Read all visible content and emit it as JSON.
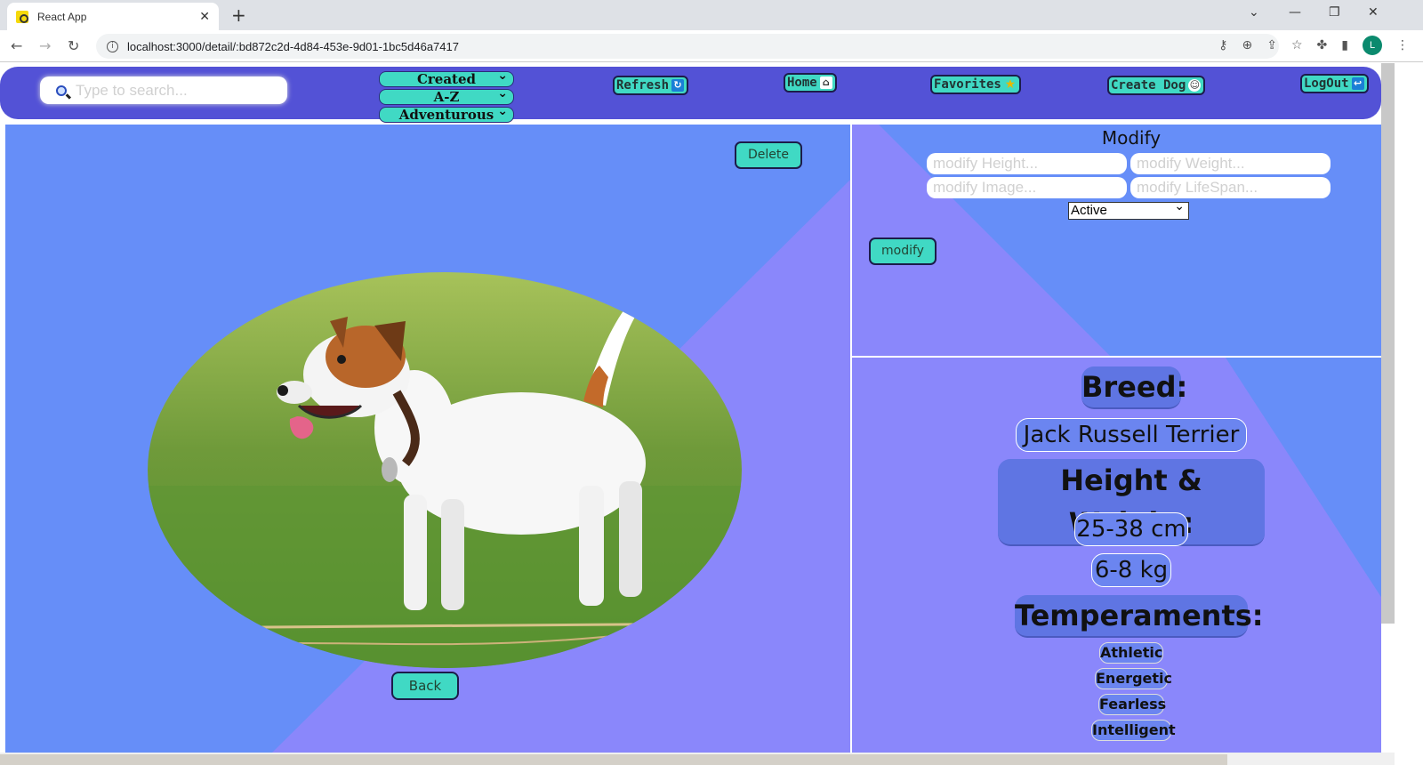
{
  "browser": {
    "tab_title": "React App",
    "url": "localhost:3000/detail/:bd872c2d-4d84-453e-9d01-1bc5d46a7417",
    "profile_initial": "L"
  },
  "navbar": {
    "search_placeholder": "Type to search...",
    "filters": [
      "Created",
      "A-Z",
      "Adventurous"
    ],
    "buttons": {
      "refresh": "Refresh",
      "home": "Home",
      "favorites": "Favorites",
      "create": "Create Dog",
      "logout": "LogOut"
    }
  },
  "detail": {
    "delete_label": "Delete",
    "back_label": "Back",
    "image_subject": "Jack Russell Terrier standing on grass"
  },
  "modify": {
    "title": "Modify",
    "height_placeholder": "modify Height...",
    "weight_placeholder": "modify Weight...",
    "image_placeholder": "modify Image...",
    "lifespan_placeholder": "modify LifeSpan...",
    "status_value": "Active",
    "button_label": "modify"
  },
  "info": {
    "breed_label": "Breed:",
    "breed_value": "Jack Russell Terrier",
    "hw_label": "Height & Weight:",
    "height_value": "25-38 cm",
    "weight_value": "6-8 kg",
    "temperaments_label": "Temperaments:",
    "temperaments": [
      "Athletic",
      "Energetic",
      "Fearless",
      "Intelligent"
    ]
  },
  "colors": {
    "navbar": "#5352d6",
    "accent_button": "#40d9c4",
    "panel_blue": "#668ef8",
    "panel_purple": "#8a87fb"
  }
}
